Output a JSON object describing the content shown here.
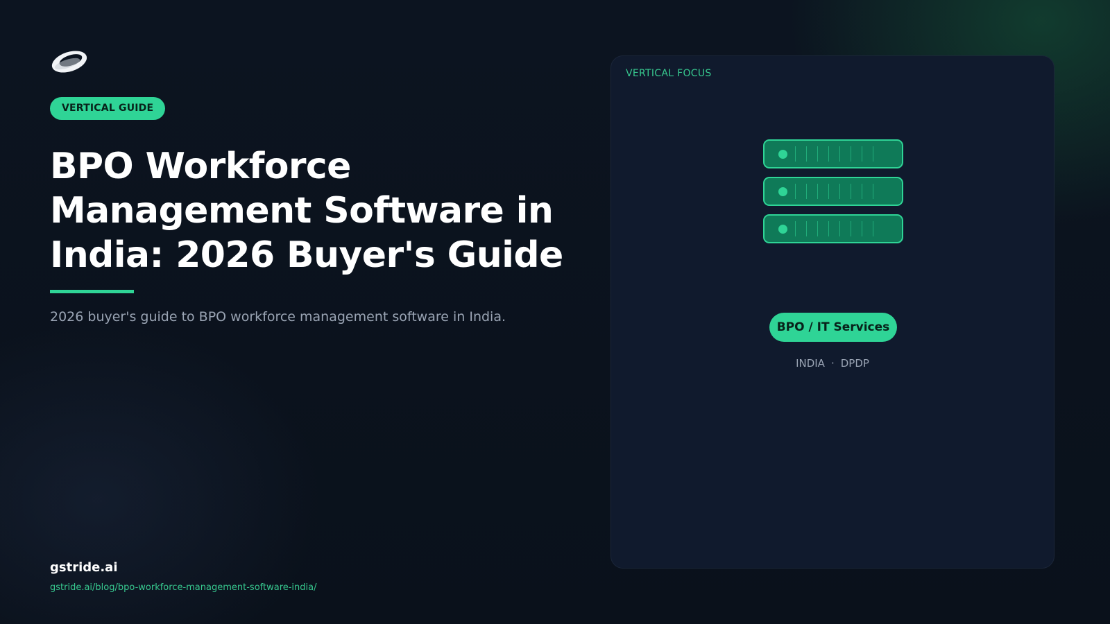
{
  "badge": "VERTICAL GUIDE",
  "title": "BPO Workforce Management Software in India: 2026 Buyer's Guide",
  "subtitle": "2026 buyer's guide to BPO workforce management software in India.",
  "footer": {
    "site_name": "gstride.ai",
    "url": "gstride.ai/blog/bpo-workforce-management-software-india/"
  },
  "panel": {
    "label": "VERTICAL FOCUS",
    "servers": [
      "server-unit",
      "server-unit",
      "server-unit"
    ],
    "vertical": "BPO / IT Services",
    "region": "INDIA",
    "separator": "·",
    "regulation": "DPDP"
  },
  "colors": {
    "background": "#0b111c",
    "panel": "#101a2d",
    "accent": "#2fd496",
    "accent_dark": "#0f7a58",
    "muted_text": "#9aa4b4",
    "link": "#37c98f"
  },
  "icons": {
    "logo": "gstride-logo-icon",
    "server": "server-rack-icon"
  }
}
